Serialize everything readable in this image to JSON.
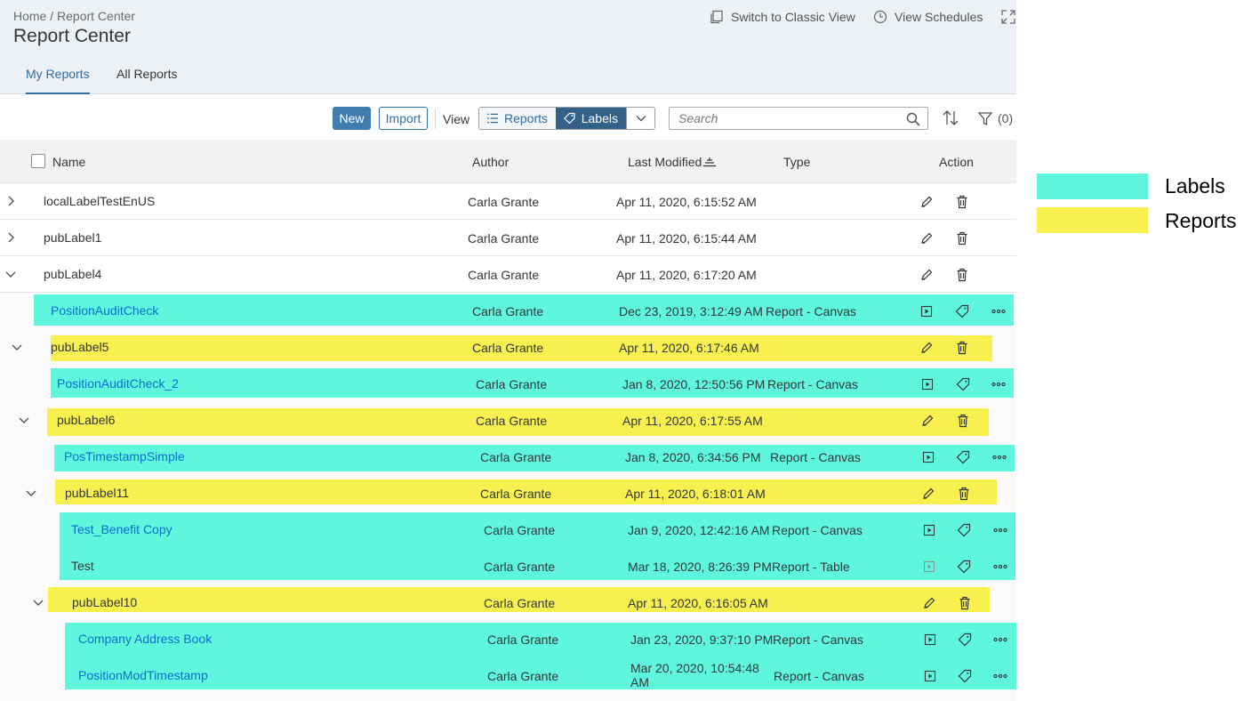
{
  "header": {
    "breadcrumb": "Home / Report Center",
    "title": "Report Center",
    "classic_view": "Switch to Classic View",
    "view_schedules": "View Schedules"
  },
  "tabs": [
    {
      "label": "My Reports",
      "active": true
    },
    {
      "label": "All Reports",
      "active": false
    }
  ],
  "toolbar": {
    "new_label": "New",
    "import_label": "Import",
    "view_label": "View",
    "seg_reports": "Reports",
    "seg_labels": "Labels",
    "search_placeholder": "Search",
    "filter_count": "(0)"
  },
  "table": {
    "columns": [
      "Name",
      "Author",
      "Last Modified",
      "Type",
      "Action"
    ]
  },
  "rows": [
    {
      "name": "localLabelTestEnUS",
      "author": "Carla Grante",
      "modified": "Apr 11, 2020, 6:15:52 AM",
      "type": "",
      "kind": "label",
      "expanded": false
    },
    {
      "name": "pubLabel1",
      "author": "Carla Grante",
      "modified": "Apr 11, 2020, 6:15:44 AM",
      "type": "",
      "kind": "label",
      "expanded": false
    },
    {
      "name": "pubLabel4",
      "author": "Carla Grante",
      "modified": "Apr 11, 2020, 6:17:20 AM",
      "type": "",
      "kind": "label",
      "expanded": true
    },
    {
      "name": "PositionAuditCheck",
      "author": "Carla Grante",
      "modified": "Dec 23, 2019, 3:12:49 AM",
      "type": "Report - Canvas",
      "kind": "report"
    },
    {
      "name": "pubLabel5",
      "author": "Carla Grante",
      "modified": "Apr 11, 2020, 6:17:46 AM",
      "type": "",
      "kind": "label",
      "expanded": true
    },
    {
      "name": "PositionAuditCheck_2",
      "author": "Carla Grante",
      "modified": "Jan 8, 2020, 12:50:56 PM",
      "type": "Report - Canvas",
      "kind": "report"
    },
    {
      "name": "pubLabel6",
      "author": "Carla Grante",
      "modified": "Apr 11, 2020, 6:17:55 AM",
      "type": "",
      "kind": "label",
      "expanded": true
    },
    {
      "name": "PosTimestampSimple",
      "author": "Carla Grante",
      "modified": "Jan 8, 2020, 6:34:56 PM",
      "type": "Report - Canvas",
      "kind": "report"
    },
    {
      "name": "pubLabel11",
      "author": "Carla Grante",
      "modified": "Apr 11, 2020, 6:18:01 AM",
      "type": "",
      "kind": "label",
      "expanded": true
    },
    {
      "name": "Test_Benefit Copy",
      "author": "Carla Grante",
      "modified": "Jan 9, 2020, 12:42:16 AM",
      "type": "Report - Canvas",
      "kind": "report"
    },
    {
      "name": "Test",
      "author": "Carla Grante",
      "modified": "Mar 18, 2020, 8:26:39 PM",
      "type": "Report - Table",
      "kind": "report"
    },
    {
      "name": "pubLabel10",
      "author": "Carla Grante",
      "modified": "Apr 11, 2020, 6:16:05 AM",
      "type": "",
      "kind": "label",
      "expanded": true
    },
    {
      "name": "Company Address Book",
      "author": "Carla Grante",
      "modified": "Jan 23, 2020, 9:37:10 PM",
      "type": "Report - Canvas",
      "kind": "report"
    },
    {
      "name": "PositionModTimestamp",
      "author": "Carla Grante",
      "modified": "Mar 20, 2020, 10:54:48 AM",
      "type": "Report - Canvas",
      "kind": "report"
    }
  ],
  "legend": [
    {
      "label": "Labels",
      "color": "#5ef7dd"
    },
    {
      "label": "Reports",
      "color": "#f8f04f"
    }
  ],
  "colors": {
    "accent": "#0a6ed1",
    "primary_button": "#427cac",
    "labels_segment_active": "#346187",
    "highlight_labels": "#5ef7dd",
    "highlight_reports": "#f8f04f"
  }
}
